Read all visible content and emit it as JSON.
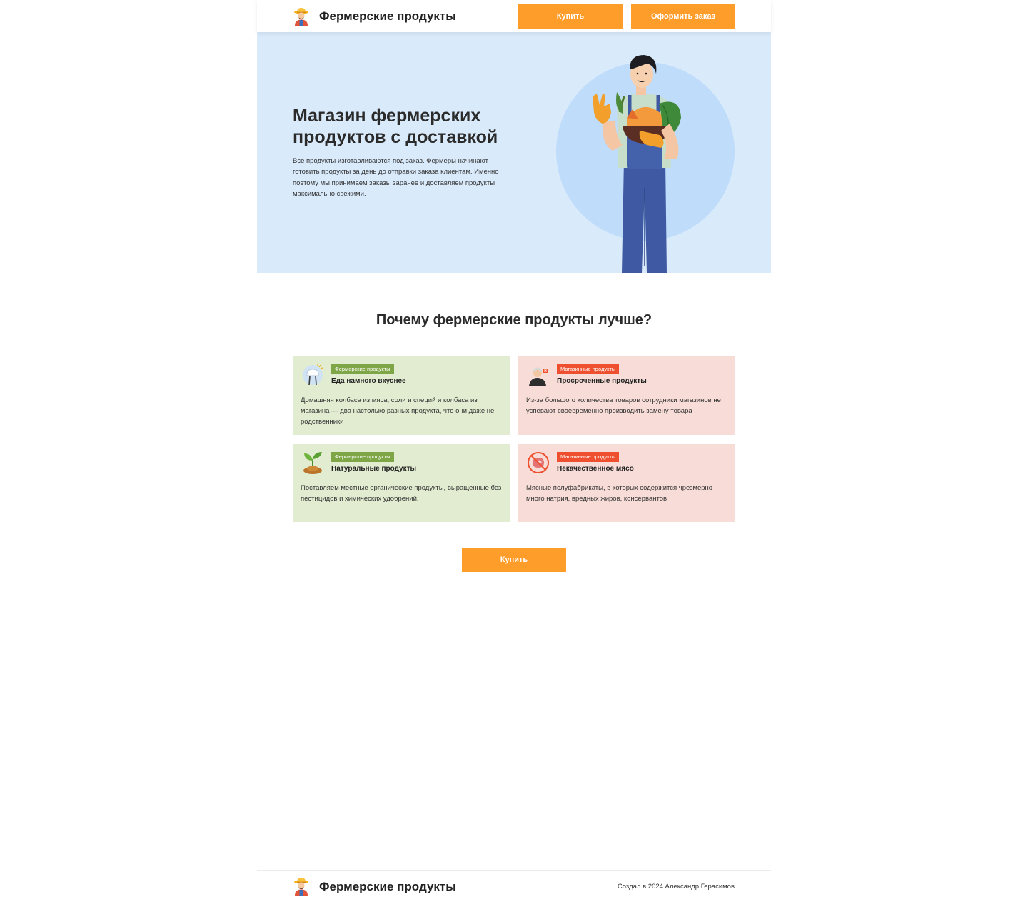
{
  "header": {
    "brand": "Фермерские продукты",
    "buy_label": "Купить",
    "order_label": "Оформить заказ"
  },
  "hero": {
    "title": "Магазин фермерских продуктов с доставкой",
    "text": "Все продукты изготавливаются под заказ. Фермеры начинают готовить продукты за день до отправки заказа клиентам. Именно поэтому мы принимаем заказы заранее и доставляем продукты максимально свежими."
  },
  "benefits": {
    "title": "Почему фермерские продукты лучше?",
    "cards": [
      {
        "icon": "chef-hat-fork-icon",
        "badge": "Фермерские продукты",
        "title": "Еда намного вкуснее",
        "text": "Домашняя колбаса из мяса, соли и специй и колбаса из магазина — два настолько разных продукта, что они даже не родственники"
      },
      {
        "icon": "old-man-icon",
        "badge": "Магазинные продукты",
        "title": "Просроченные продукты",
        "text": "Из-за большого количества товаров сотрудники магазинов не успевают своевременно производить замену товара"
      },
      {
        "icon": "sprout-icon",
        "badge": "Фермерские продукты",
        "title": "Натуральные продукты",
        "text": "Поставляем местные органические продукты, выращенные без пестицидов и химических удобрений."
      },
      {
        "icon": "no-meat-icon",
        "badge": "Магазинные продукты",
        "title": "Некачественное мясо",
        "text": "Мясные полуфабрикаты, в которых содержится чрезмерно много натрия, вредных жиров, консервантов"
      }
    ],
    "buy_label": "Купить"
  },
  "footer": {
    "brand": "Фермерские продукты",
    "copyright": "Создал в 2024 Александр Герасимов"
  },
  "colors": {
    "accent": "#ff9d2a",
    "hero_bg": "#d9eafb",
    "good_card": "#e1ecd0",
    "bad_card": "#f7dcd7",
    "good_badge": "#7ea646",
    "bad_badge": "#ee4f2e"
  }
}
